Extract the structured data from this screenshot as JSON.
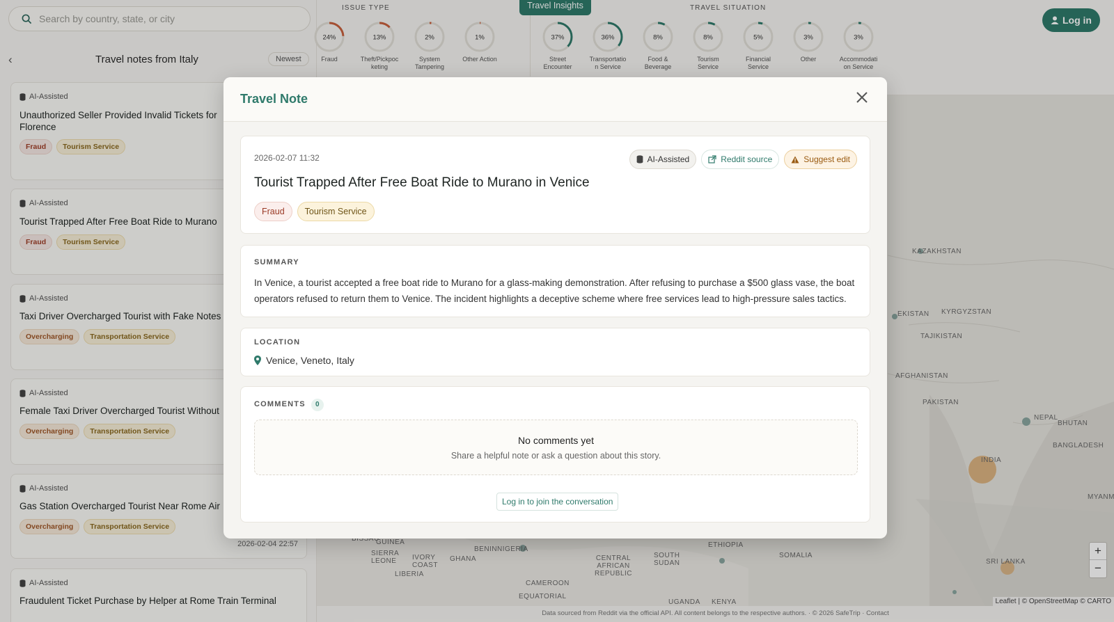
{
  "search": {
    "placeholder": "Search by country, state, or city"
  },
  "list": {
    "title": "Travel notes from Italy",
    "sort_label": "Newest",
    "cards": [
      {
        "ai": "AI-Assisted",
        "title": "Unauthorized Seller Provided Invalid Tickets for Florence",
        "tags": [
          "Fraud",
          "Tourism Service"
        ],
        "date": ""
      },
      {
        "ai": "AI-Assisted",
        "title": "Tourist Trapped After Free Boat Ride to Murano",
        "tags": [
          "Fraud",
          "Tourism Service"
        ],
        "date": ""
      },
      {
        "ai": "AI-Assisted",
        "title": "Taxi Driver Overcharged Tourist with Fake Notes",
        "tags": [
          "Overcharging",
          "Transportation Service"
        ],
        "date": ""
      },
      {
        "ai": "AI-Assisted",
        "title": "Female Taxi Driver Overcharged Tourist Without",
        "tags": [
          "Overcharging",
          "Transportation Service"
        ],
        "date": ""
      },
      {
        "ai": "AI-Assisted",
        "title": "Gas Station Overcharged Tourist Near Rome Air",
        "tags": [
          "Overcharging",
          "Transportation Service"
        ],
        "date": "2026-02-04 22:57"
      },
      {
        "ai": "AI-Assisted",
        "title": "Fraudulent Ticket Purchase by Helper at Rome Train Terminal",
        "tags": [],
        "date": ""
      }
    ]
  },
  "stats": {
    "issue_label": "ISSUE TYPE",
    "situation_label": "TRAVEL SITUATION",
    "insights_tab": "Travel Insights",
    "issue_rings": [
      {
        "pct": "24%",
        "label": "Fraud",
        "value": 24,
        "color": "#c9613e"
      },
      {
        "pct": "13%",
        "label": "Theft/Pickpoc keting",
        "value": 13,
        "color": "#c9613e"
      },
      {
        "pct": "2%",
        "label": "System Tampering",
        "value": 2,
        "color": "#c9613e"
      },
      {
        "pct": "1%",
        "label": "Other Action",
        "value": 1,
        "color": "#c9613e"
      }
    ],
    "situation_rings": [
      {
        "pct": "37%",
        "label": "Street Encounter",
        "value": 37,
        "color": "#2f7a6b"
      },
      {
        "pct": "36%",
        "label": "Transportatio n Service",
        "value": 36,
        "color": "#2f7a6b"
      },
      {
        "pct": "8%",
        "label": "Food & Beverage",
        "value": 8,
        "color": "#2f7a6b"
      },
      {
        "pct": "8%",
        "label": "Tourism Service",
        "value": 8,
        "color": "#2f7a6b"
      },
      {
        "pct": "5%",
        "label": "Financial Service",
        "value": 5,
        "color": "#2f7a6b"
      },
      {
        "pct": "3%",
        "label": "Other",
        "value": 3,
        "color": "#2f7a6b"
      },
      {
        "pct": "3%",
        "label": "Accommodati on Service",
        "value": 3,
        "color": "#2f7a6b"
      }
    ]
  },
  "header": {
    "login_label": "Log in"
  },
  "map": {
    "labels": [
      "KAZAKHSTAN",
      "KYRGYZSTAN",
      "TAJIKISTAN",
      "EKISTAN",
      "AFGHANISTAN",
      "PAKISTAN",
      "NEPAL",
      "BHUTAN",
      "BANGLADESH",
      "INDIA",
      "MYANM",
      "SRI LANKA",
      "ETHIOPIA",
      "SOMALIA",
      "SOUTH SUDAN",
      "CENTRAL AFRICAN REPUBLIC",
      "CAMEROON",
      "NIGERIA",
      "BENIN",
      "GHANA",
      "IVORY COAST",
      "LIBERIA",
      "SIERRA LEONE",
      "GUINEA",
      "BISSAU",
      "EQUATORIAL",
      "UGANDA",
      "KENYA"
    ],
    "zoom_in": "+",
    "zoom_out": "−",
    "attribution": "Leaflet | © OpenStreetMap © CARTO"
  },
  "footer": {
    "text": "Data sourced from Reddit via the official API. All content belongs to the respective authors. · © 2026 SafeTrip · Contact"
  },
  "modal": {
    "title": "Travel Note",
    "date": "2026-02-07 11:32",
    "badge_ai": "AI-Assisted",
    "badge_reddit": "Reddit source",
    "badge_suggest": "Suggest edit",
    "note_title": "Tourist Trapped After Free Boat Ride to Murano in Venice",
    "tags": [
      "Fraud",
      "Tourism Service"
    ],
    "summary_label": "SUMMARY",
    "summary": "In Venice, a tourist accepted a free boat ride to Murano for a glass-making demonstration. After refusing to purchase a $500 glass vase, the boat operators refused to return them to Venice. The incident highlights a deceptive scheme where free services lead to high-pressure sales tactics.",
    "location_label": "LOCATION",
    "location": "Venice, Veneto, Italy",
    "comments_label": "COMMENTS",
    "comments_count": "0",
    "empty_title": "No comments yet",
    "empty_sub": "Share a helpful note or ask a question about this story.",
    "join_label": "Log in to join the conversation"
  },
  "colors": {
    "accent": "#2f7a6b",
    "issue_ring": "#c9613e"
  }
}
